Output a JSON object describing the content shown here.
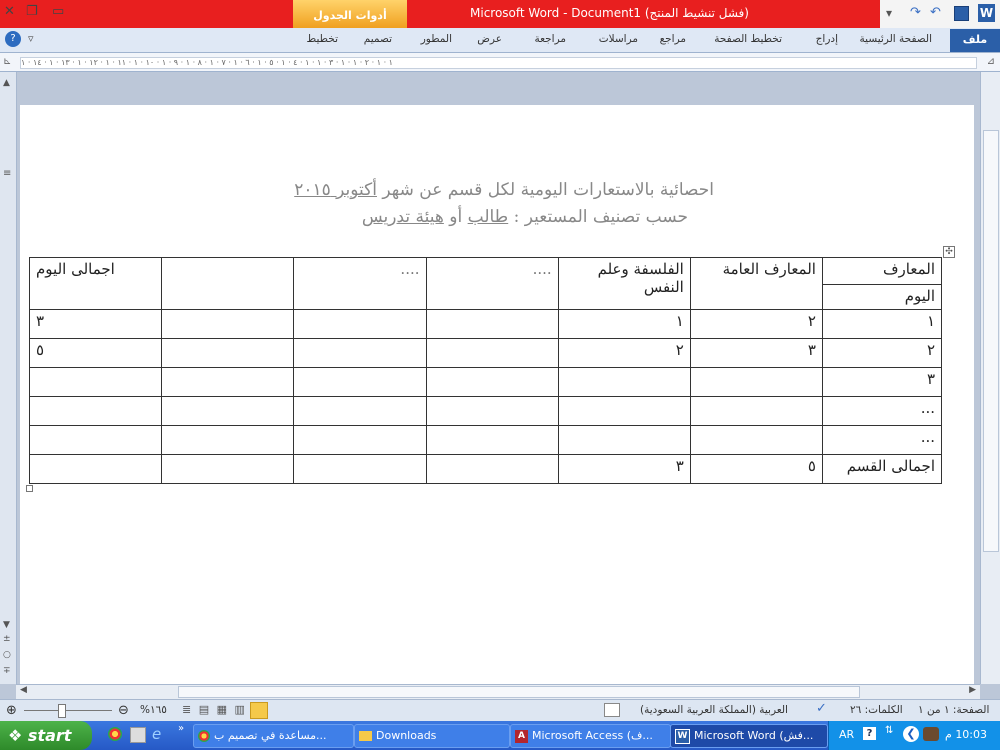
{
  "window": {
    "title": "Microsoft Word  -  Document1 (فشل تنشيط المنتج)",
    "context_tab": "أدوات الجدول",
    "controls": [
      "✕",
      "❐",
      "▭"
    ]
  },
  "ribbon": {
    "file_tab": "ملف",
    "tabs": [
      "الصفحة الرئيسية",
      "إدراج",
      "تخطيط الصفحة",
      "مراجع",
      "مراسلات",
      "مراجعة",
      "عرض",
      "المطور",
      "تصميم",
      "تخطيط"
    ]
  },
  "ruler": {
    "marks": "١ · ١ · ٢ · ١ · ١ · ٣ · ١ · ١ · ٤ · ١ · ٥ · ١ · ٦ · ١ · ٧ · ١ · ٨ · ١ · ٩ · ١ · ١٠ · ١ · ١١ · ١ · ١٢ · ١ · ١٣ · ١ · ١٤ · ١"
  },
  "document": {
    "title_line1_a": "احصائية بالاستعارات اليومية لكل قسم عن شهر ",
    "title_line1_b": "أكتوبر ٢٠١٥",
    "title_line2_a": "حسب تصنيف المستعير : ",
    "title_line2_b": "طالب",
    "title_line2_c": "  أو  ",
    "title_line2_d": "هيئة تدريس",
    "table": {
      "header_top": "المعارف",
      "header_bottom": "اليوم",
      "col_headers": [
        "المعارف العامة",
        "الفلسفة وعلم النفس",
        "....",
        "....",
        "",
        "اجمالى اليوم"
      ],
      "rows": [
        [
          "١",
          "٢",
          "١",
          "",
          "",
          "",
          "٣"
        ],
        [
          "٢",
          "٣",
          "٢",
          "",
          "",
          "",
          "٥"
        ],
        [
          "٣",
          "",
          "",
          "",
          "",
          "",
          ""
        ],
        [
          "...",
          "",
          "",
          "",
          "",
          "",
          ""
        ],
        [
          "...",
          "",
          "",
          "",
          "",
          "",
          ""
        ],
        [
          "اجمالى القسم",
          "٥",
          "٣",
          "",
          "",
          "",
          ""
        ]
      ]
    }
  },
  "status_bar": {
    "page": "الصفحة: ١ من ١",
    "words": "الكلمات: ٢٦",
    "language": "العربية (المملكة العربية السعودية)",
    "zoom": "%١٦٥"
  },
  "taskbar": {
    "start": "start",
    "tasks": [
      "مساعدة في تصميم ب...",
      "Downloads",
      "Microsoft Access (ف...",
      "Microsoft Word (فش..."
    ],
    "lang": "AR",
    "clock": "10:03 م"
  }
}
